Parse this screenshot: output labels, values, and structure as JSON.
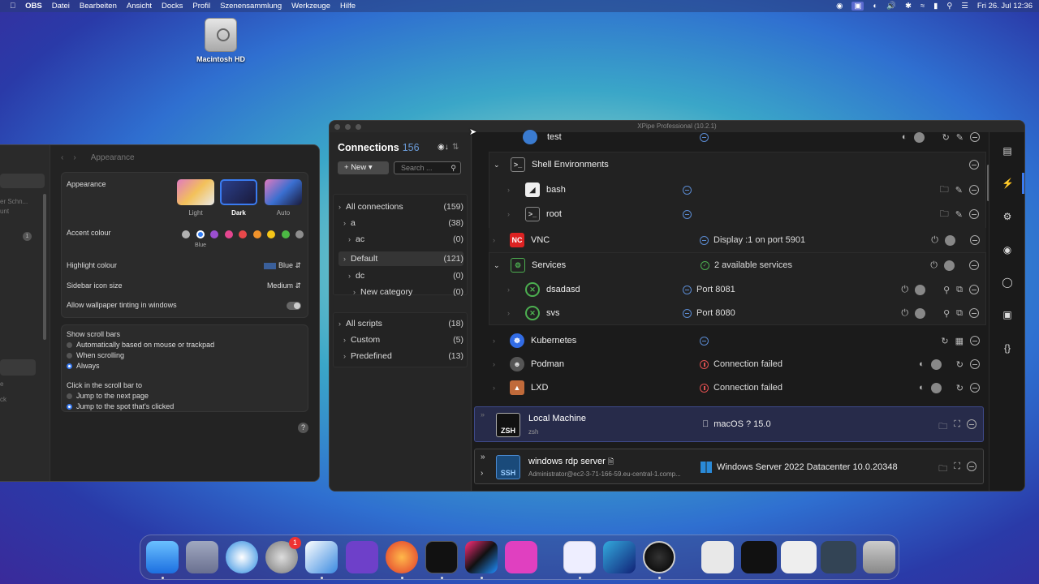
{
  "menubar": {
    "items": [
      "OBS",
      "Datei",
      "Bearbeiten",
      "Ansicht",
      "Docks",
      "Profil",
      "Szenensammlung",
      "Werkzeuge",
      "Hilfe"
    ],
    "clock": "Fri 26. Jul  12:36"
  },
  "desktop": {
    "disk_label": "Macintosh HD"
  },
  "settings": {
    "title": "Appearance",
    "sidebar_frag1": "er Schn...",
    "sidebar_frag2": "unt",
    "sidebar_frag3": "e",
    "sidebar_frag4": "ck",
    "sidebar_badge": "1",
    "appearance_label": "Appearance",
    "modes": [
      "Light",
      "Dark",
      "Auto"
    ],
    "accent_label": "Accent colour",
    "accent_selected": "Blue",
    "accent_colors": [
      "#b0b0b0",
      "#2f7cf6",
      "#9b4fd1",
      "#e4468f",
      "#e8484a",
      "#f0922b",
      "#f5c518",
      "#4cb944",
      "#8e8e8e"
    ],
    "highlight_label": "Highlight colour",
    "highlight_value": "Blue",
    "sidebar_icon_label": "Sidebar icon size",
    "sidebar_icon_value": "Medium",
    "tinting_label": "Allow wallpaper tinting in windows",
    "scroll_label": "Show scroll bars",
    "scroll_opts": [
      "Automatically based on mouse or trackpad",
      "When scrolling",
      "Always"
    ],
    "click_label": "Click in the scroll bar to",
    "click_opts": [
      "Jump to the next page",
      "Jump to the spot that's clicked"
    ],
    "help": "?"
  },
  "xpipe": {
    "title": "XPipe Professional (10.2.1)",
    "connections_label": "Connections",
    "connections_count": "156",
    "new_label": "New",
    "search_placeholder": "Search ...",
    "tree": [
      {
        "label": "All connections",
        "count": "(159)"
      },
      {
        "label": "a",
        "count": "(38)"
      },
      {
        "label": "ac",
        "count": "(0)"
      },
      {
        "label": "Default",
        "count": "(121)"
      },
      {
        "label": "dc",
        "count": "(0)"
      },
      {
        "label": "New category",
        "count": "(0)"
      }
    ],
    "scripts": [
      {
        "label": "All scripts",
        "count": "(18)"
      },
      {
        "label": "Custom",
        "count": "(5)"
      },
      {
        "label": "Predefined",
        "count": "(13)"
      }
    ],
    "rows": [
      {
        "name": "test",
        "status": ""
      },
      {
        "name": "Shell Environments",
        "status": ""
      },
      {
        "name": "bash",
        "status": ""
      },
      {
        "name": "root",
        "status": ""
      },
      {
        "name": "VNC",
        "status": "Display :1 on port 5901"
      },
      {
        "name": "Services",
        "status": "2 available services"
      },
      {
        "name": "dsadasd",
        "status": "Port 8081"
      },
      {
        "name": "svs",
        "status": "Port 8080"
      },
      {
        "name": "Kubernetes",
        "status": ""
      },
      {
        "name": "Podman",
        "status": "Connection failed"
      },
      {
        "name": "LXD",
        "status": "Connection failed"
      }
    ],
    "local": {
      "name": "Local Machine",
      "sub": "zsh",
      "status": "macOS ? 15.0",
      "icon_text": "ZSH"
    },
    "rdp": {
      "name": "windows rdp server",
      "sub": "Administrator@ec2-3-71-166-59.eu-central-1.comp...",
      "status": "Windows Server 2022 Datacenter 10.0.20348",
      "icon_text": "SSH"
    }
  },
  "dock": {
    "settings_badge": "1"
  }
}
